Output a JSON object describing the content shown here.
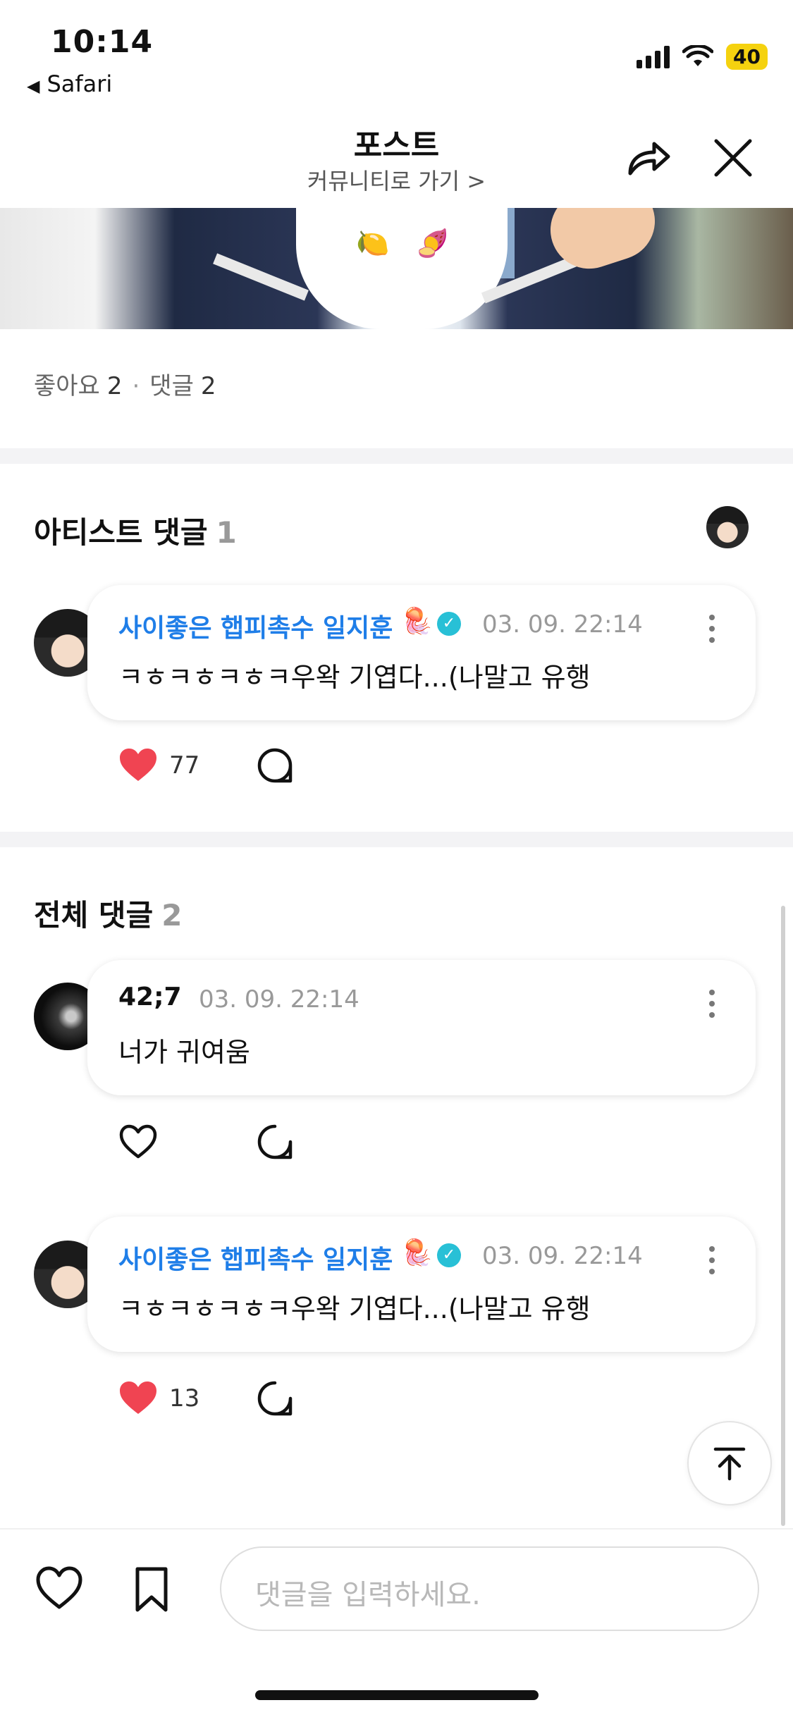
{
  "status_bar": {
    "time": "10:14",
    "back_app": "Safari",
    "battery": "40"
  },
  "header": {
    "title": "포스트",
    "subtitle": "커뮤니티로 가기 >"
  },
  "stats": {
    "likes_label": "좋아요",
    "likes_count": "2",
    "comments_label": "댓글",
    "comments_count": "2"
  },
  "artist_section": {
    "title": "아티스트 댓글",
    "count": "1",
    "comments": [
      {
        "author": "사이좋은 햅피촉수 일지훈",
        "date": "03. 09. 22:14",
        "text": "ㅋㅎㅋㅎㅋㅎㅋ우왁 기엽다...(나말고 유행",
        "likes": "77",
        "liked": true
      }
    ]
  },
  "all_section": {
    "title": "전체 댓글",
    "count": "2",
    "comments": [
      {
        "author": "42;7",
        "date": "03. 09. 22:14",
        "text": "너가 귀여움",
        "likes": "",
        "liked": false
      },
      {
        "author": "사이좋은 햅피촉수 일지훈",
        "date": "03. 09. 22:14",
        "text": "ㅋㅎㅋㅎㅋㅎㅋ우왁 기엽다...(나말고 유행",
        "likes": "13",
        "liked": true
      }
    ]
  },
  "bottom_bar": {
    "input_placeholder": "댓글을 입력하세요."
  },
  "colors": {
    "author_blue": "#1f7ee8",
    "verified_teal": "#28c0d6",
    "heart_red": "#f04452",
    "battery_yellow": "#f5d20f"
  },
  "icons": {
    "verified": "verified-badge-icon",
    "jellyfish": "jellyfish-emoji"
  }
}
